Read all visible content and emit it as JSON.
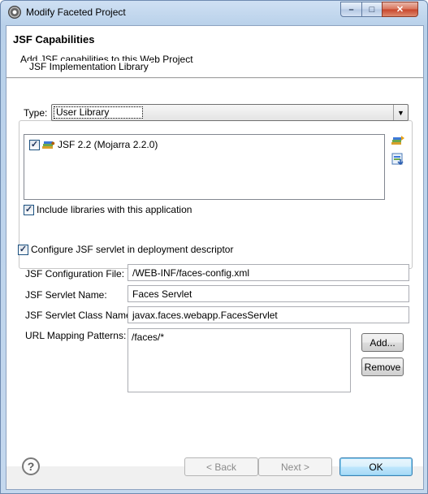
{
  "window": {
    "title": "Modify Faceted Project",
    "minimize": "–",
    "maximize": "□",
    "close": "✕"
  },
  "banner": {
    "title": "JSF Capabilities",
    "description": "Add JSF capabilities to this Web Project"
  },
  "implementation": {
    "group_title": "JSF Implementation Library",
    "type_label": "Type:",
    "type_value": "User Library",
    "libraries": [
      {
        "label": "JSF 2.2 (Mojarra 2.2.0)",
        "checked": true
      }
    ],
    "include_label": "Include libraries with this application",
    "include_checked": true
  },
  "servlet": {
    "configure_label": "Configure JSF servlet in deployment descriptor",
    "configure_checked": true,
    "config_file_label": "JSF Configuration File:",
    "config_file_value": "/WEB-INF/faces-config.xml",
    "servlet_name_label": "JSF Servlet Name:",
    "servlet_name_value": "Faces Servlet",
    "servlet_class_label": "JSF Servlet Class Name:",
    "servlet_class_value": "javax.faces.webapp.FacesServlet",
    "url_patterns_label": "URL Mapping Patterns:",
    "url_patterns": [
      "/faces/*"
    ],
    "add_button": "Add...",
    "remove_button": "Remove"
  },
  "footer": {
    "help": "?",
    "back": "< Back",
    "next": "Next >",
    "ok": "OK"
  },
  "icons": [
    "app-icon",
    "library-icon",
    "manage-libraries-icon",
    "download-library-icon",
    "help-icon"
  ]
}
